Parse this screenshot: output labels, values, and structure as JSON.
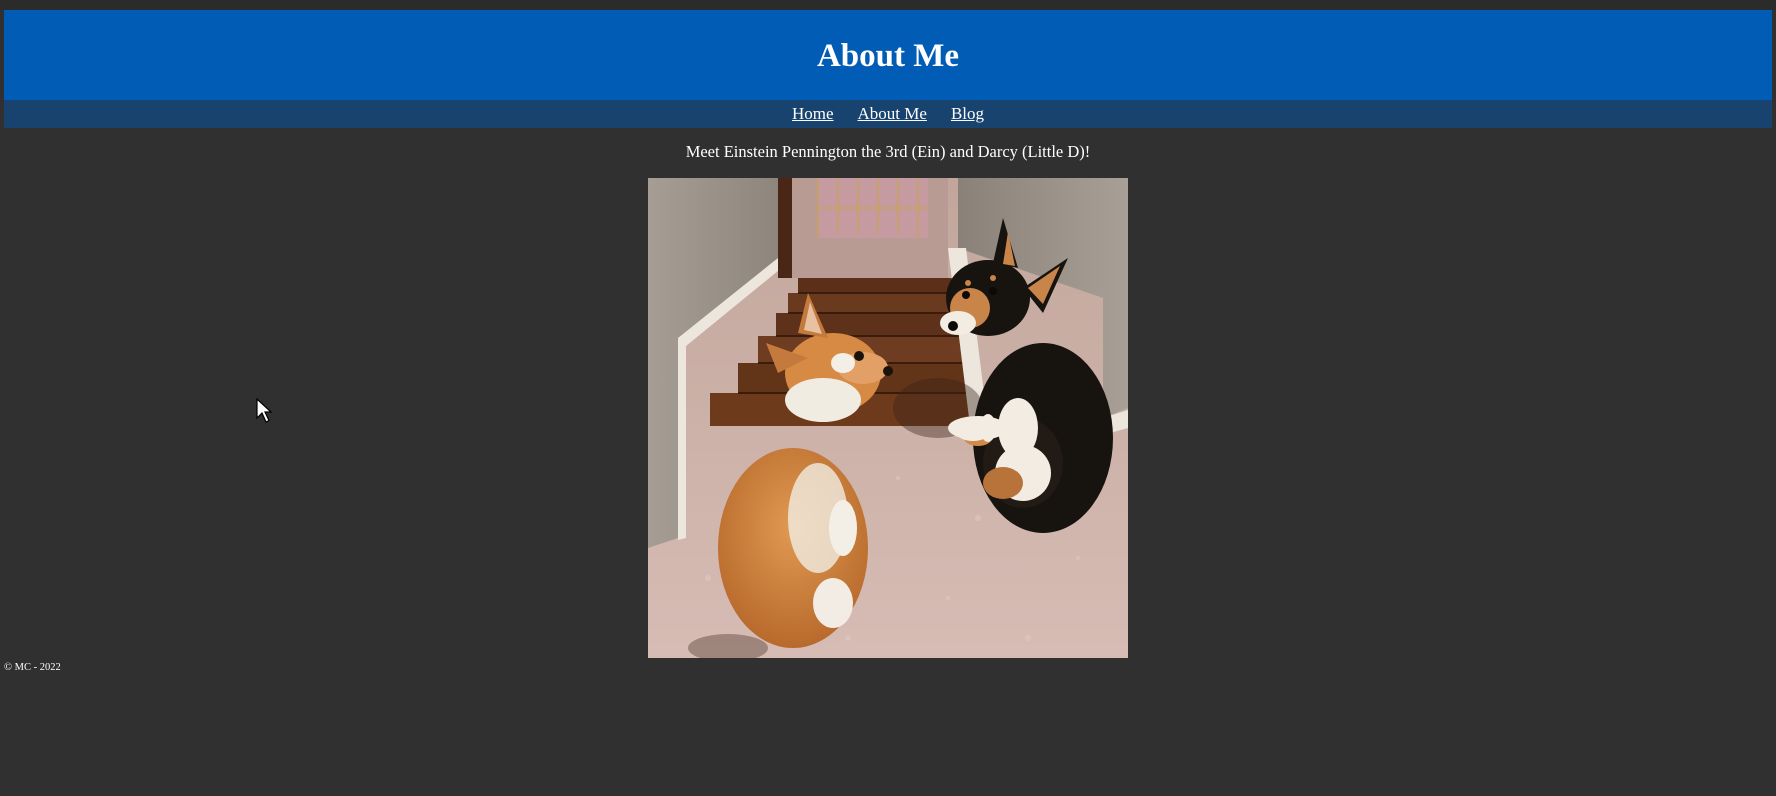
{
  "header": {
    "title": "About Me"
  },
  "nav": {
    "items": [
      {
        "label": "Home"
      },
      {
        "label": "About Me"
      },
      {
        "label": "Blog"
      }
    ]
  },
  "main": {
    "intro": "Meet Einstein Pennington the 3rd (Ein) and Darcy (Little D)!",
    "photo_icon": "photo-of-two-corgis"
  },
  "footer": {
    "text": "© MC - 2022"
  },
  "colors": {
    "page_background": "#303030",
    "banner": "#005cb5",
    "nav_bar": "#17436e",
    "text": "#ffffff"
  }
}
